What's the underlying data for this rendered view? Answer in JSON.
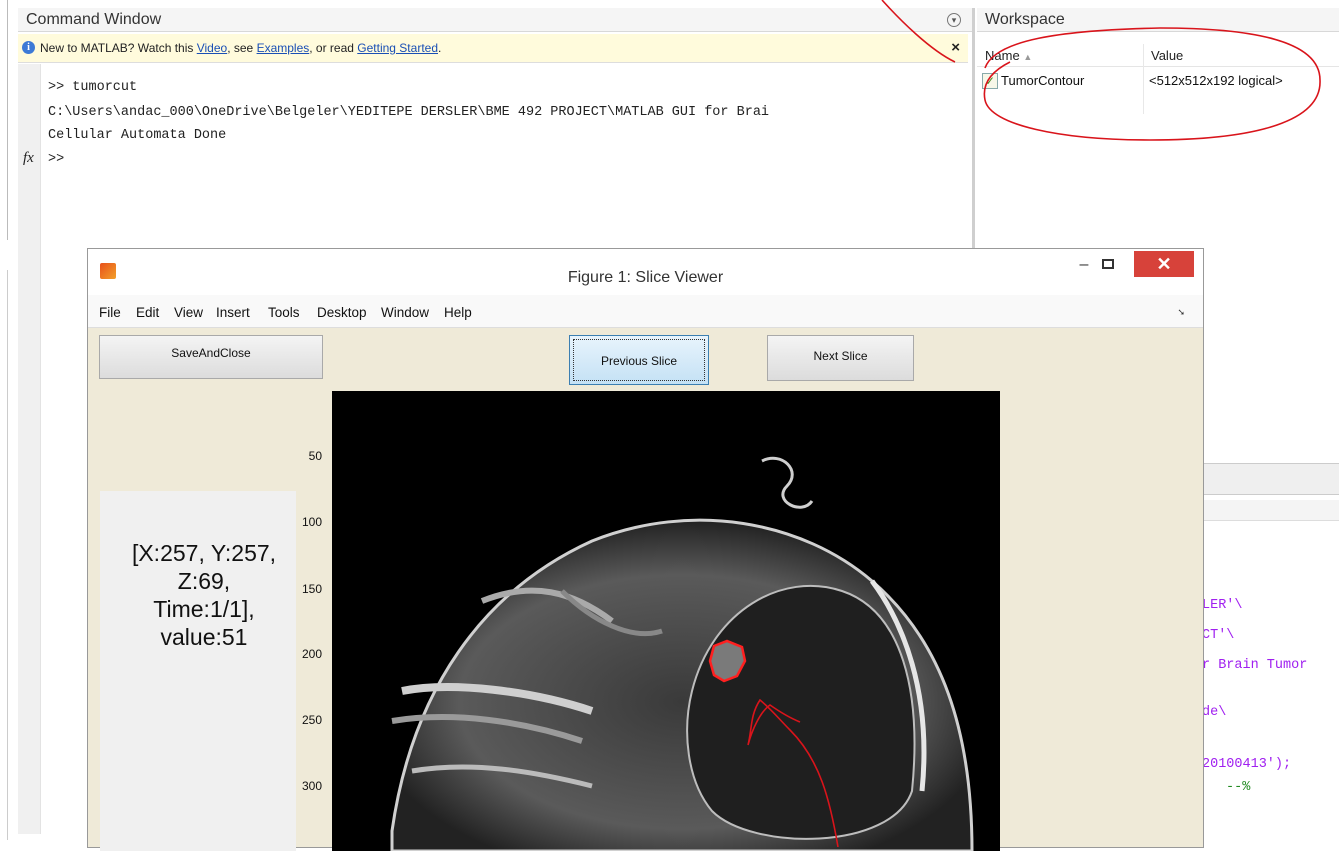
{
  "command_window": {
    "title": "Command Window",
    "banner": {
      "prefix": "New to MATLAB? Watch this ",
      "video_link": "Video",
      "mid1": ", see ",
      "examples_link": "Examples",
      "mid2": ", or read ",
      "getting_started_link": "Getting Started",
      "suffix": ".",
      "close": "×"
    },
    "lines": [
      ">> tumorcut",
      "C:\\Users\\andac_000\\OneDrive\\Belgeler\\YEDITEPE DERSLER\\BME 492 PROJECT\\MATLAB GUI for Brai",
      "Cellular Automata Done",
      ">>"
    ],
    "fx": "fx"
  },
  "workspace": {
    "title": "Workspace",
    "columns": {
      "name": "Name",
      "sort": "▲",
      "value": "Value"
    },
    "rows": [
      {
        "name": "TumorContour",
        "value": "<512x512x192 logical>",
        "checked": "✓"
      }
    ]
  },
  "editor_fragments": [
    {
      "text": "LER'\\",
      "color": "#a020f0"
    },
    {
      "text": "CT'\\",
      "color": "#a020f0"
    },
    {
      "text": "r Brain Tumor",
      "color": "#a020f0"
    },
    {
      "text": "de\\",
      "color": "#a020f0"
    },
    {
      "text": "20100413');",
      "color": "#a020f0",
      "suffix": ""
    },
    {
      "text": "--%",
      "color": "#228b22"
    }
  ],
  "figure": {
    "title": "Figure 1: Slice Viewer",
    "minimize": "–",
    "close": "✕",
    "menu": [
      "File",
      "Edit",
      "View",
      "Insert",
      "Tools",
      "Desktop",
      "Window",
      "Help"
    ],
    "dock": "➘",
    "buttons": {
      "save_close": "SaveAndClose",
      "previous": "Previous Slice",
      "next": "Next Slice"
    },
    "info_text": "[X:257, Y:257,\nZ:69,\nTime:1/1],\nvalue:51",
    "y_ticks": [
      "50",
      "100",
      "150",
      "200",
      "250",
      "300"
    ]
  },
  "colors": {
    "annotation": "#d9141b",
    "banner_bg": "#fffbdc",
    "figure_bg": "#efead8",
    "close_red": "#d7423a"
  }
}
